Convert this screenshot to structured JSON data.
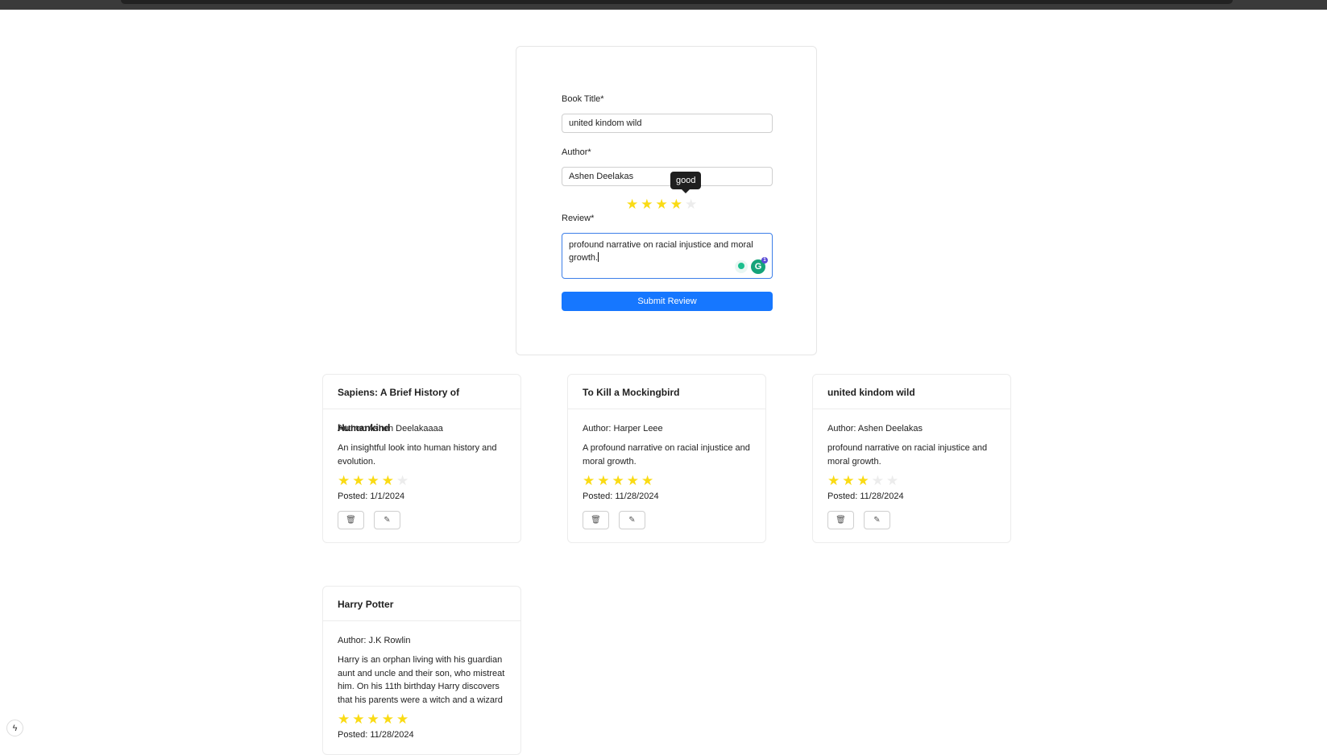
{
  "form": {
    "title_label": "Book Title*",
    "title_value": "united kindom wild",
    "author_label": "Author*",
    "author_value": "Ashen Deelakas",
    "rating": 4,
    "rating_tooltip": "good",
    "review_label": "Review*",
    "review_value": "profound narrative on racial injustice and moral growth.",
    "submit_label": "Submit Review"
  },
  "reviews": [
    {
      "title": "Sapiens: A Brief History of Humankind",
      "author": "Author: Ashen Deelakaaaa",
      "review": "An insightful look into human history and evolution.",
      "rating": 4,
      "posted": "Posted: 1/1/2024"
    },
    {
      "title": "To Kill a Mockingbird",
      "author": "Author: Harper Leee",
      "review": "A profound narrative on racial injustice and moral growth.",
      "rating": 5,
      "posted": "Posted: 11/28/2024"
    },
    {
      "title": "united kindom wild",
      "author": "Author: Ashen Deelakas",
      "review": "profound narrative on racial injustice and moral growth.",
      "rating": 3,
      "posted": "Posted: 11/28/2024"
    },
    {
      "title": "Harry Potter",
      "author": "Author: J.K Rowlin",
      "review": "Harry is an orphan living with his guardian aunt and uncle and their son, who mistreat him. On his 11th birthday Harry discovers that his parents were a witch and a wizard",
      "rating": 5,
      "posted": "Posted: 11/28/2024"
    }
  ],
  "icons": {
    "star": "★",
    "delete": "🗑",
    "edit": "✎",
    "dev_logo": "ϟ"
  },
  "colors": {
    "primary": "#1677ff",
    "star_on": "#fadb14",
    "star_off": "#ececec"
  }
}
